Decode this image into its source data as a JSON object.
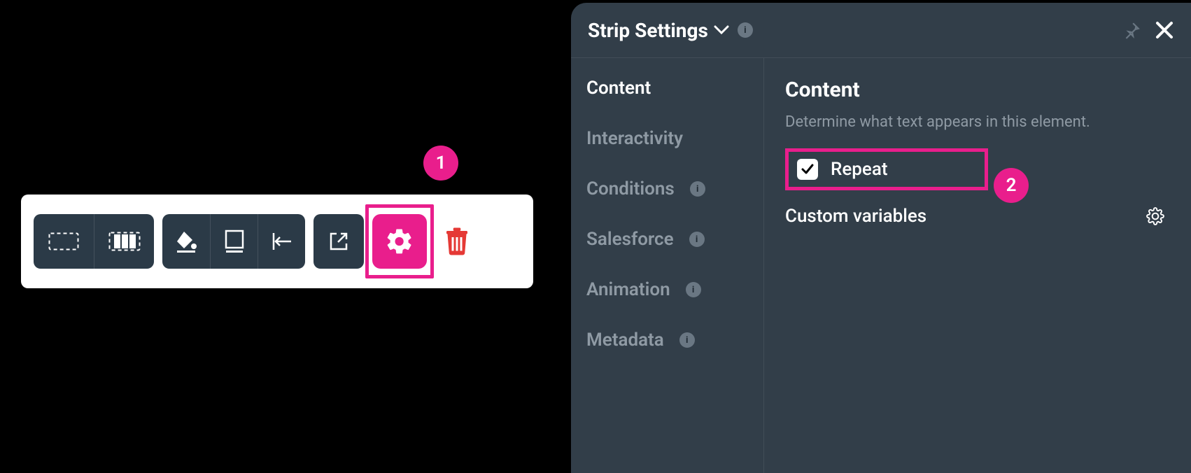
{
  "callouts": {
    "one": "1",
    "two": "2"
  },
  "toolbar": {
    "icons": {
      "rect_dashed": "dashed-rect-icon",
      "filmstrip": "filmstrip-icon",
      "fill": "fill-icon",
      "border": "border-icon",
      "align_left": "align-left-icon",
      "open_external": "open-external-icon",
      "gear": "gear-icon",
      "trash": "trash-icon"
    }
  },
  "panel": {
    "title": "Strip Settings",
    "nav": {
      "content": "Content",
      "interactivity": "Interactivity",
      "conditions": "Conditions",
      "salesforce": "Salesforce",
      "animation": "Animation",
      "metadata": "Metadata"
    },
    "content": {
      "heading": "Content",
      "description": "Determine what text appears in this element.",
      "repeat_label": "Repeat",
      "repeat_checked": true,
      "custom_variables_label": "Custom variables"
    }
  }
}
